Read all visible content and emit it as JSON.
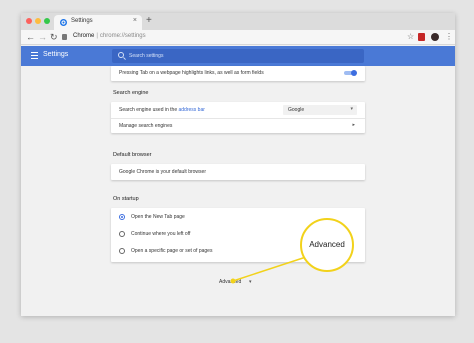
{
  "tab": {
    "title": "Settings",
    "close": "×",
    "new_tab": "+"
  },
  "toolbar": {
    "back": "←",
    "forward": "→",
    "reload": "↻",
    "url_host": "Chrome",
    "url_sep": "|",
    "url_rest": "chrome://settings",
    "star": "☆",
    "menu": "⋮"
  },
  "header": {
    "title": "Settings",
    "search_placeholder": "Search settings"
  },
  "top_card": {
    "text": "Pressing Tab on a webpage highlights links, as well as form fields",
    "toggle_on": true
  },
  "search_engine": {
    "title": "Search engine",
    "row1_prefix": "Search engine used in the ",
    "row1_link": "address bar",
    "select_value": "Google",
    "select_chevron": "▾",
    "row2": "Manage search engines",
    "row2_arrow": "▸"
  },
  "default_browser": {
    "title": "Default browser",
    "row": "Google Chrome is your default browser"
  },
  "on_startup": {
    "title": "On startup",
    "options": [
      {
        "label": "Open the New Tab page",
        "selected": true
      },
      {
        "label": "Continue where you left off",
        "selected": false
      },
      {
        "label": "Open a specific page or set of pages",
        "selected": false
      }
    ]
  },
  "advanced": {
    "label": "Advanced",
    "chevron": "▾"
  },
  "callout": {
    "label": "Advanced",
    "color": "#f2d21b"
  },
  "colors": {
    "header": "#4a79d6",
    "accent": "#3d6ee0"
  }
}
